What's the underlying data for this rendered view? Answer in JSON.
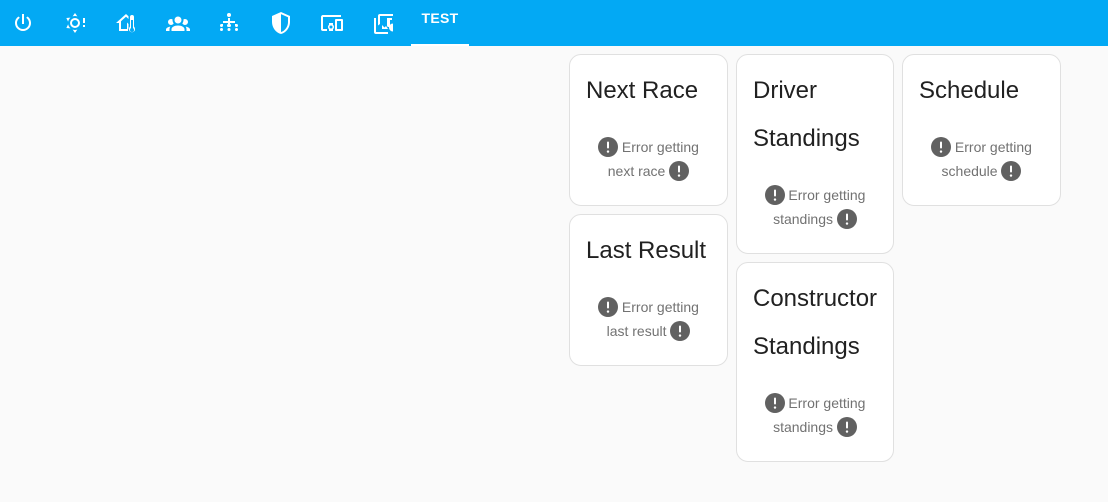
{
  "header": {
    "tabs": [
      {
        "icon": "power-icon"
      },
      {
        "icon": "weather-sunny-alert-icon"
      },
      {
        "icon": "home-thermometer-icon"
      },
      {
        "icon": "account-group-icon"
      },
      {
        "icon": "family-tree-icon"
      },
      {
        "icon": "shield-half-icon"
      },
      {
        "icon": "devices-icon"
      },
      {
        "icon": "image-music-icon"
      }
    ],
    "active_tab_label": "TEST"
  },
  "cards": {
    "next_race": {
      "title": "Next Race",
      "error_line1": "Error getting",
      "error_line2": "next race"
    },
    "last_result": {
      "title": "Last Result",
      "error_line1": "Error getting",
      "error_line2": "last result"
    },
    "driver_standings": {
      "title_line1": "Driver",
      "title_line2": "Standings",
      "error_line1": "Error getting",
      "error_line2": "standings"
    },
    "constructor_standings": {
      "title_line1": "Constructor",
      "title_line2": "Standings",
      "error_line1": "Error getting",
      "error_line2": "standings"
    },
    "schedule": {
      "title": "Schedule",
      "error_line1": "Error getting",
      "error_line2": "schedule"
    }
  },
  "colors": {
    "header": "#03a9f4",
    "background": "#fafafa",
    "card": "#ffffff",
    "error_icon": "#616161"
  }
}
